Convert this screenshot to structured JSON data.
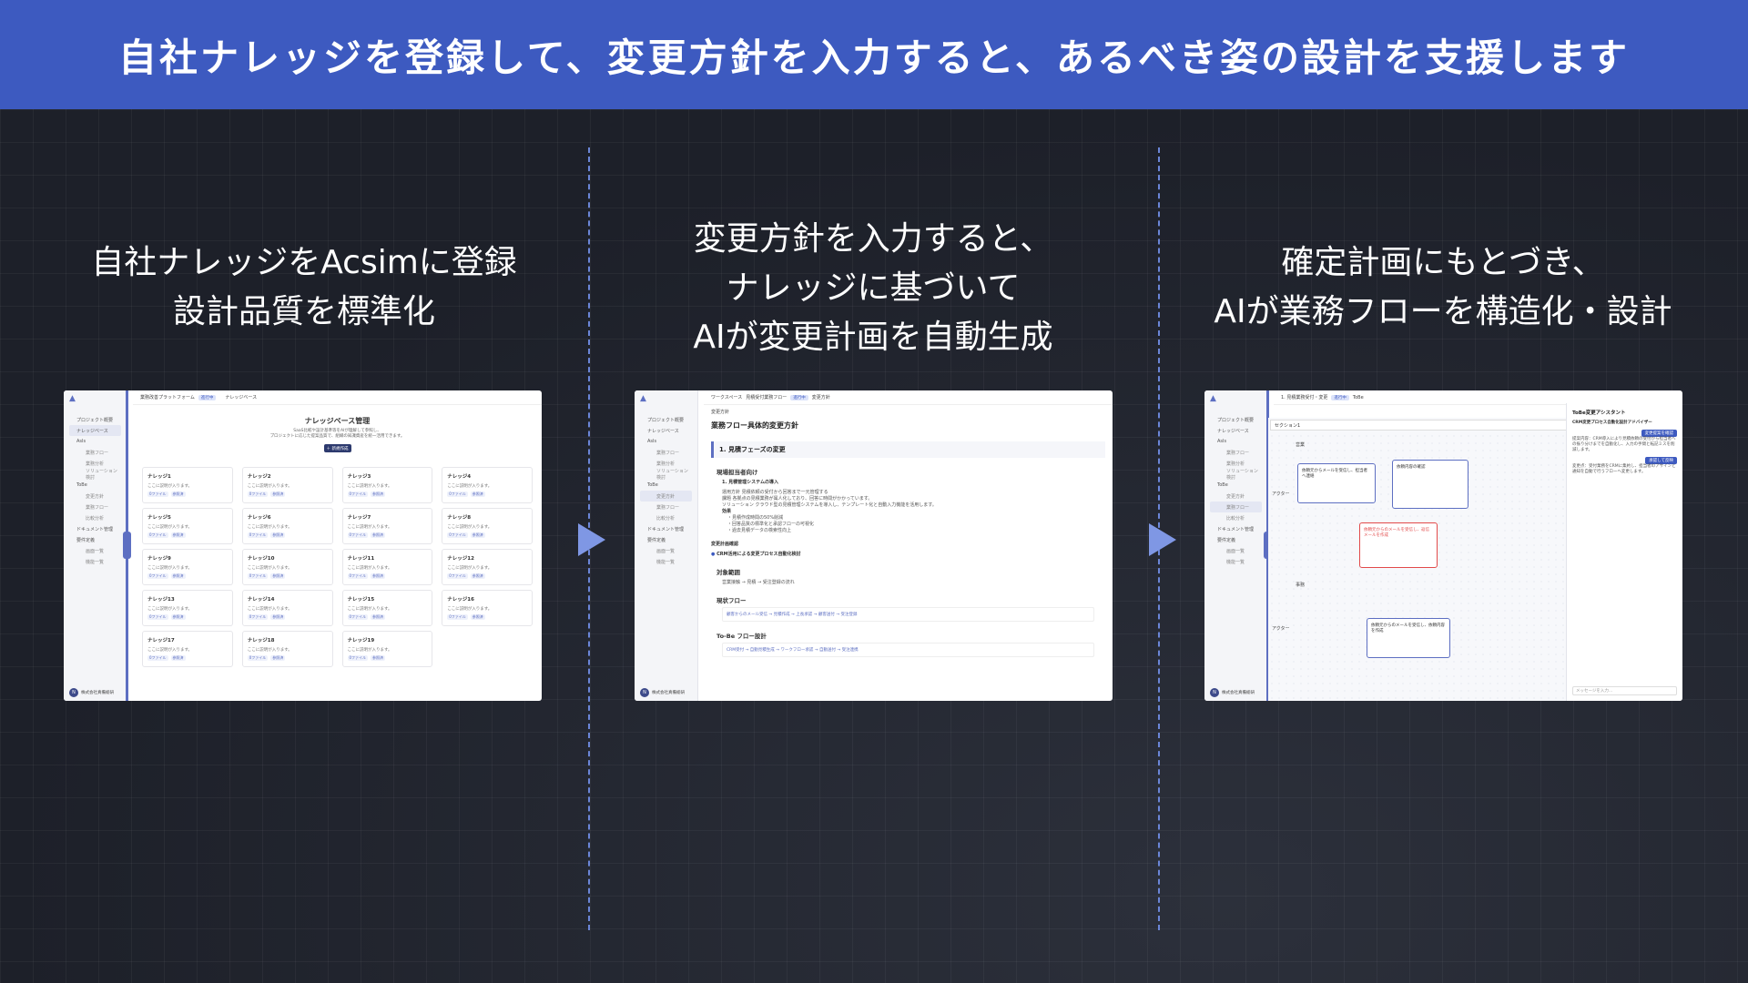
{
  "banner": {
    "title": "自社ナレッジを登録して、変更方針を入力すると、あるべき姿の設計を支援します"
  },
  "columns": [
    {
      "line1": "自社ナレッジをAcsimに登録",
      "line2": "設計品質を標準化"
    },
    {
      "line1": "変更方針を入力すると、",
      "line2": "ナレッジに基づいて",
      "line3": "AIが変更計画を自動生成"
    },
    {
      "line1": "確定計画にもとづき、",
      "line2": "AIが業務フローを構造化・設計"
    }
  ],
  "sidebar": {
    "items": [
      "プロジェクト概要",
      "ナレッジベース",
      "AsIs",
      "業務フロー",
      "業務分析",
      "ソリューション検討",
      "ToBe",
      "変更方針",
      "業務フロー",
      "比較分析",
      "ドキュメント管理",
      "要件定義",
      "画面一覧",
      "機能一覧"
    ],
    "company": "株式会社真備総研"
  },
  "shot1": {
    "crumb_project": "業務改善プラットフォーム",
    "crumb_badge": "進行中",
    "crumb_page": "ナレッジベース",
    "title": "ナレッジベース管理",
    "subtitle1": "SaaS比較や設計基準等をAIが理解して参照し、",
    "subtitle2": "プロジェクトに応じた提案品質で、組織の知識資産を統一活用できます。",
    "new_button": "＋ 新規作成",
    "cards": [
      "ナレッジ1",
      "ナレッジ2",
      "ナレッジ3",
      "ナレッジ4",
      "ナレッジ5",
      "ナレッジ6",
      "ナレッジ7",
      "ナレッジ8",
      "ナレッジ9",
      "ナレッジ10",
      "ナレッジ11",
      "ナレッジ12",
      "ナレッジ13",
      "ナレッジ14",
      "ナレッジ15",
      "ナレッジ16",
      "ナレッジ17",
      "ナレッジ18",
      "ナレッジ19"
    ],
    "card_desc": "ここに説明が入ります。",
    "card_tag1": "0ファイル",
    "card_tag2": "参照済"
  },
  "shot2": {
    "crumb_project": "ワークスペース",
    "crumb_flow": "見積受付業務フロー",
    "crumb_badge": "進行中",
    "crumb_page": "変更方針",
    "label": "変更方針",
    "heading": "業務フロー具体的変更方針",
    "section1": "1. 見積フェーズの変更",
    "group1": "現場担当者向け",
    "item1": "1. 見積管理システムの導入",
    "l1": "運用方針 見積依頼の受付から回答まで一元管理する",
    "l2": "課題 各拠点の見積業務が属人化しており、回答に時間がかかっています。",
    "l3": "ソリューション クラウド型の見積管理システムを導入し、テンプレート化と自動入力機能を活用します。",
    "l4": "効果",
    "e1": "・見積作成時間の50%削減",
    "e2": "・回答品質の標準化と承認フローの可視化",
    "e3": "・過去見積データの検索性向上",
    "plan_title": "変更計画確認",
    "plan_item": "CRM活用による変更プロセス自動化検討",
    "target": "対象範囲",
    "target_desc": "営業接触 → 見積 → 受注登録の流れ",
    "asis": "現状フロー",
    "asis_flow": "顧客からのメール受信 → 見積作成 → 上長承認 → 顧客送付 → 受注登録",
    "tobe": "To-Be フロー設計",
    "tobe_flow": "CRM受付 → 自動見積生成 → ワークフロー承認 → 自動送付 → 受注連携"
  },
  "shot3": {
    "crumb_flow": "1. 見積業務受付・変更",
    "crumb_badge": "進行中",
    "tab_tobe": "ToBe",
    "section": "セクション1",
    "lane1": "営業",
    "lane2": "事務",
    "actor": "アクター",
    "node1": "依頼元からメールを受信し、担当者へ連絡",
    "node2": "依頼内容の確認",
    "node3": "依頼元からのメールを受信し、返信メールを作成",
    "node4": "依頼元からのメールを受信し、依頼内容を作成",
    "assistant_title": "ToBe変更アシスタント",
    "assistant_sub": "CRM変更プロセス自動化設計アドバイザー",
    "assistant_btn1": "変更提案を確認",
    "assistant_text1": "提案内容：CRM導入により見積依頼の受付から担当者への振り分けまでを自動化し、入力の手間と転記ミスを削減します。",
    "assistant_btn2": "承認して反映",
    "assistant_text2": "変更点：受付業務をCRMに集約し、担当者のアサインと通知を自動で行うフローへ変更します。",
    "assistant_input": "メッセージを入力..."
  }
}
